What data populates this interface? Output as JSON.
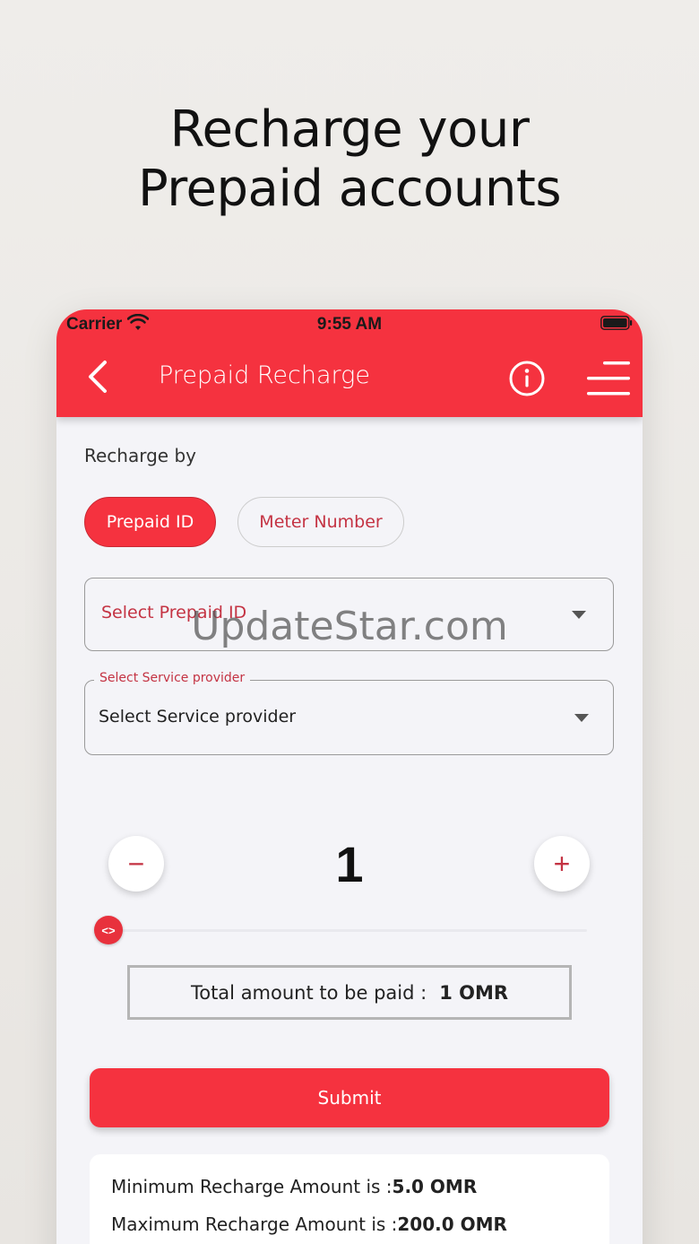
{
  "promo": {
    "line1": "Recharge your",
    "line2": "Prepaid accounts"
  },
  "status_bar": {
    "carrier": "Carrier",
    "time": "9:55 AM"
  },
  "app_bar": {
    "title": "Prepaid Recharge"
  },
  "recharge_by": {
    "label": "Recharge by",
    "options": [
      {
        "label": "Prepaid ID",
        "selected": true
      },
      {
        "label": "Meter Number",
        "selected": false
      }
    ]
  },
  "prepaid_field": {
    "placeholder": "Select Prepaid ID"
  },
  "provider_field": {
    "legend": "Select Service provider",
    "value": "Select Service provider"
  },
  "watermark": "UpdateStar.com",
  "quantity": {
    "minus": "−",
    "plus": "+",
    "value": "1",
    "slider_fraction": 0
  },
  "slider_thumb_glyph": "<>",
  "total": {
    "label": "Total amount to be paid :",
    "value": "1 OMR"
  },
  "submit_label": "Submit",
  "limits": {
    "min_label": "Minimum Recharge Amount is :",
    "min_value": "5.0 OMR",
    "max_label": "Maximum Recharge Amount is :",
    "max_value": "200.0 OMR"
  },
  "colors": {
    "primary": "#f5323f",
    "accent_text": "#c43343",
    "background": "#f4f4f8"
  }
}
